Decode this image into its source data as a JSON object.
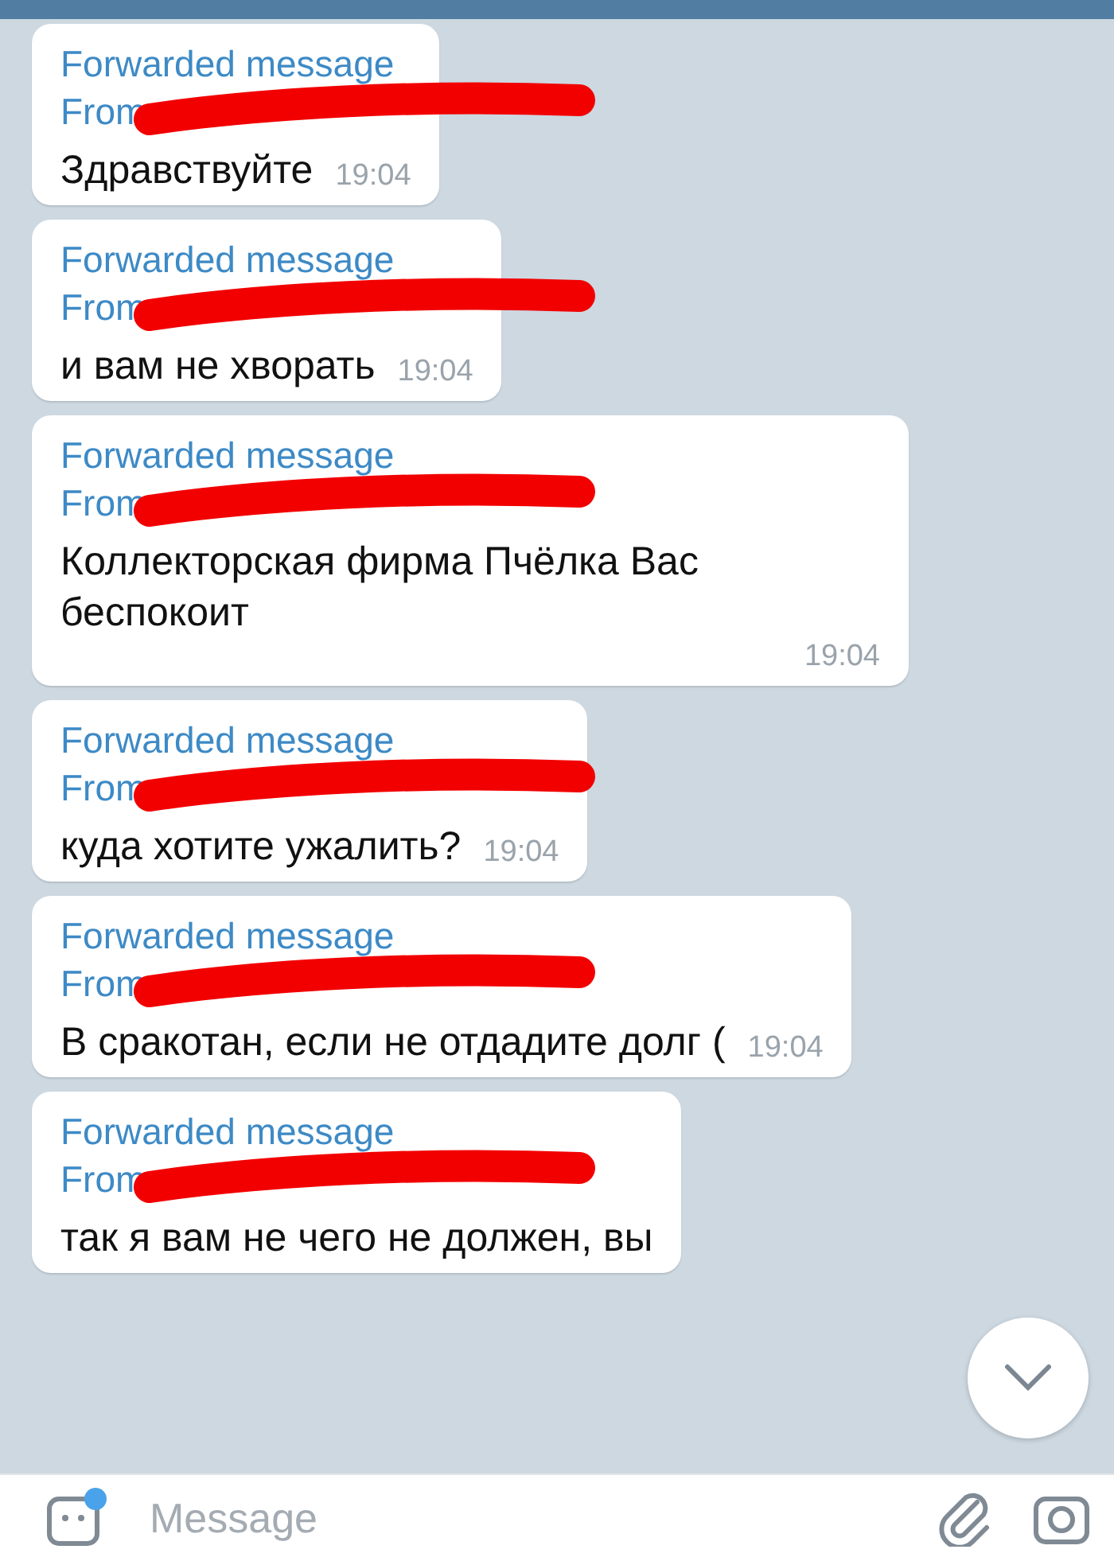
{
  "messages": [
    {
      "forward_label": "Forwarded message",
      "from_label": "From",
      "text": "Здравствуйте",
      "time": "19:04"
    },
    {
      "forward_label": "Forwarded message",
      "from_label": "From",
      "text": "и вам не хворать",
      "time": "19:04"
    },
    {
      "forward_label": "Forwarded message",
      "from_label": "From",
      "text": "Коллекторская фирма Пчёлка Вас беспокоит",
      "time": "19:04"
    },
    {
      "forward_label": "Forwarded message",
      "from_label": "From",
      "text": "куда хотите ужалить?",
      "time": "19:04"
    },
    {
      "forward_label": "Forwarded message",
      "from_label": "From",
      "text": "В сракотан, если не отдадите долг (",
      "time": "19:04"
    },
    {
      "forward_label": "Forwarded message",
      "from_label": "From",
      "text": "так я вам не чего не должен, вы"
    }
  ],
  "composer": {
    "placeholder": "Message",
    "emoji_badge": true
  }
}
